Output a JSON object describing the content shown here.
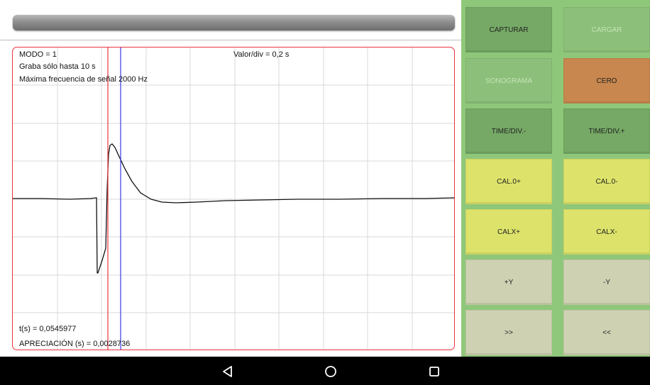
{
  "scope": {
    "mode": "MODO = 1",
    "record": "Graba sólo hasta 10 s",
    "max_freq": "Máxima frecuencia de señal 2000 Hz",
    "value_div": "Valor/div = 0,2 s",
    "time": "t(s) = 0,0545977",
    "appreciation": "APRECIACIÓN (s) = 0,0028736"
  },
  "buttons": {
    "capturar": "CAPTURAR",
    "cargar": "CARGAR",
    "sonograma": "SONOGRAMA",
    "cero": "CERO",
    "time_div_minus": "TIME/DIV.-",
    "time_div_plus": "TIME/DIV.+",
    "cal0_plus": "CAL.0+",
    "cal0_minus": "CAL.0-",
    "calx_plus": "CALX+",
    "calx_minus": "CALX-",
    "plus_y": "+Y",
    "minus_y": "-Y",
    "forward": ">>",
    "back": "<<"
  },
  "colors": {
    "scope_border": "#e8343f",
    "cursor_red": "#e8343f",
    "cursor_blue": "#3a3ae0",
    "panel": "#8fc77a",
    "orange_button": "#c7874e",
    "yellow_button": "#dde36a"
  },
  "nav": {
    "back_icon": "triangle-back-icon",
    "home_icon": "circle-home-icon",
    "recents_icon": "square-recents-icon"
  }
}
